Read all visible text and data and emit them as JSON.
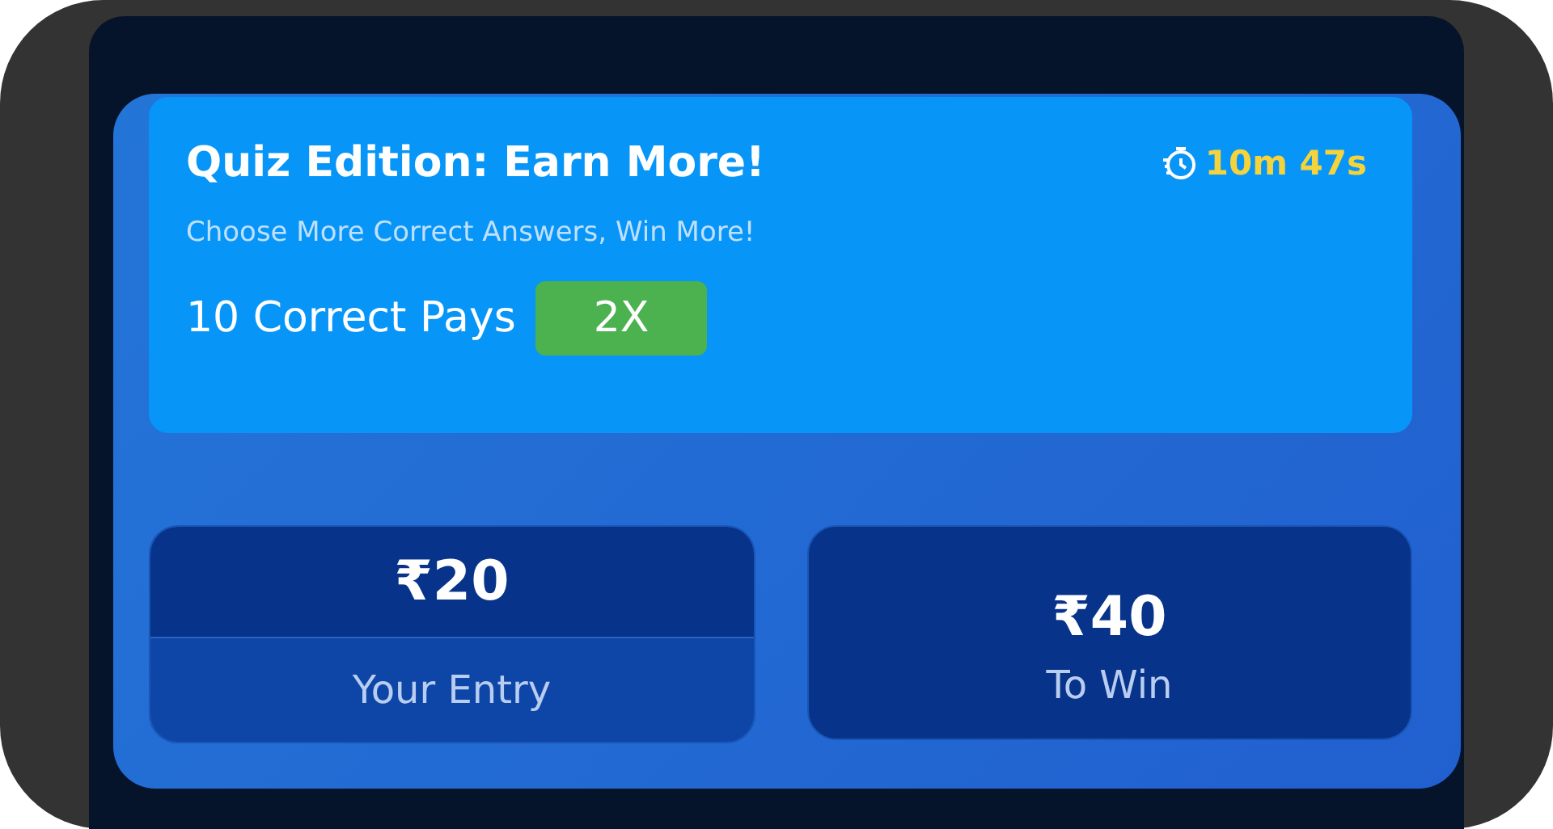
{
  "promo": {
    "title": "Quiz Edition: Earn More!",
    "timer": "10m 47s",
    "subtitle": "Choose More Correct Answers, Win More!",
    "pays_label": "10 Correct Pays",
    "multiplier": "2X"
  },
  "entry": {
    "value": "₹20",
    "label": "Your Entry"
  },
  "prize": {
    "amount": "₹40",
    "label": "To Win"
  }
}
